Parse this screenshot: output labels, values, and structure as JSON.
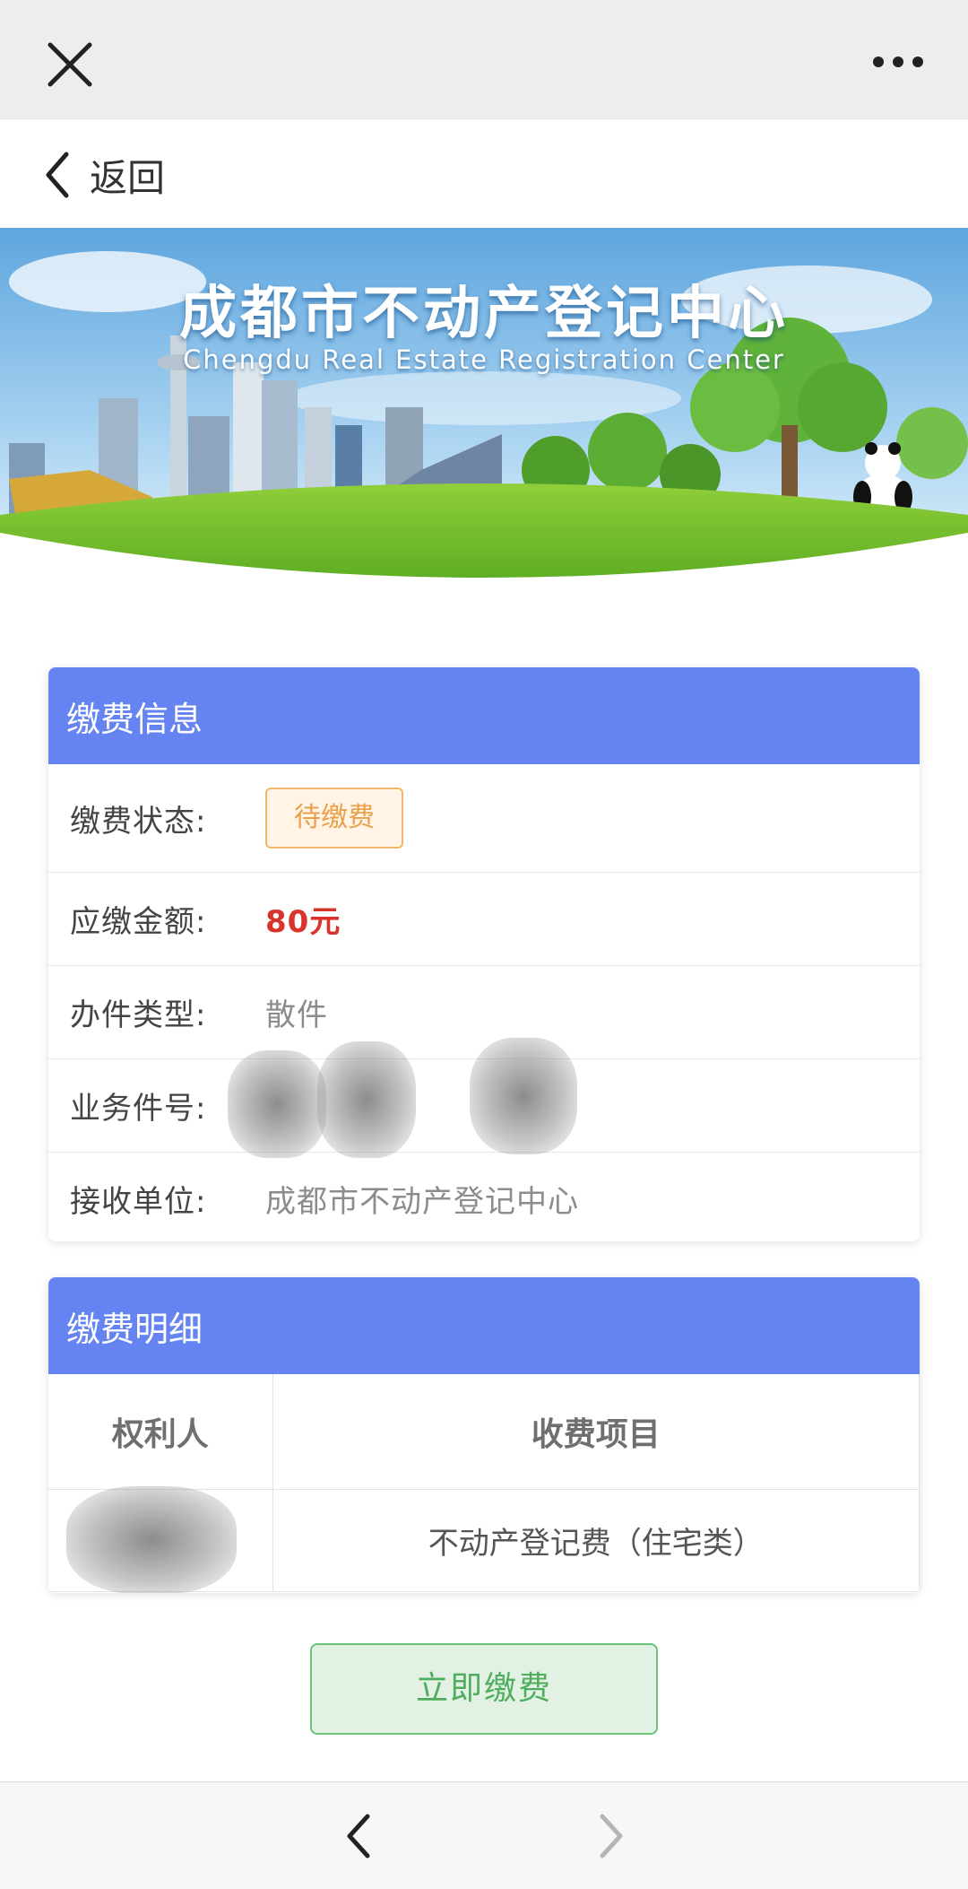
{
  "browser": {
    "close_icon": "close-icon",
    "more_icon": "more-icon"
  },
  "nav": {
    "back_label": "返回"
  },
  "banner": {
    "title": "成都市不动产登记中心",
    "subtitle": "Chengdu Real Estate Registration Center"
  },
  "payment_info": {
    "header": "缴费信息",
    "rows": [
      {
        "label": "缴费状态:",
        "value": "待缴费"
      },
      {
        "label": "应缴金额:",
        "value": "80元"
      },
      {
        "label": "办件类型:",
        "value": "散件"
      },
      {
        "label": "业务件号:",
        "value": ""
      },
      {
        "label": "接收单位:",
        "value": "成都市不动产登记中心"
      }
    ]
  },
  "payment_details": {
    "header": "缴费明细",
    "columns": [
      "权利人",
      "收费项目"
    ],
    "rows": [
      {
        "holder": "",
        "item": "不动产登记费（住宅类）"
      }
    ]
  },
  "pay_button": {
    "label": "立即缴费"
  },
  "colors": {
    "header_blue": "#6584f2",
    "amount_red": "#d9342b",
    "badge_orange": "#e9a04a",
    "pay_green": "#4fae5e"
  }
}
